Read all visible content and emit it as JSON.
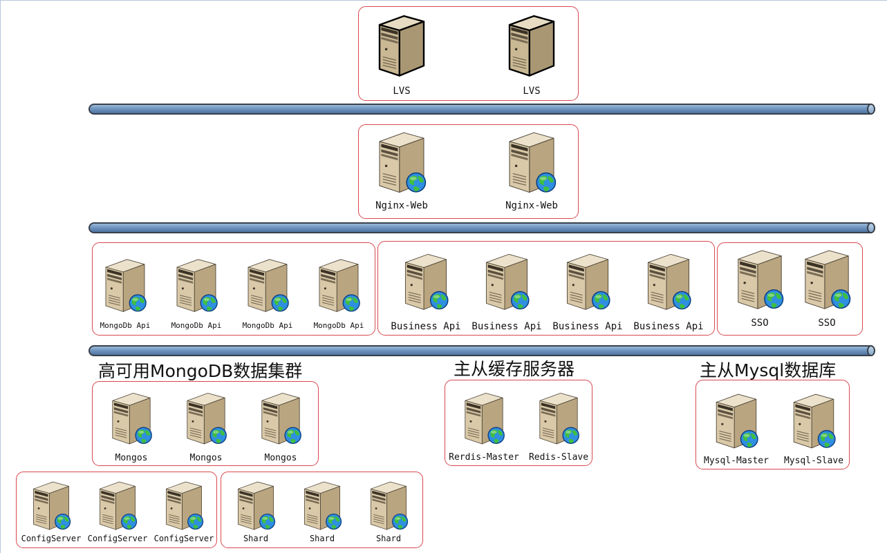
{
  "tiers": {
    "lvs": [
      "LVS",
      "LVS"
    ],
    "nginx": [
      "Nginx-Web",
      "Nginx-Web"
    ],
    "mongo_api": [
      "MongoDb Api",
      "MongoDb Api",
      "MongoDb Api",
      "MongoDb Api"
    ],
    "business_api": [
      "Business Api",
      "Business Api",
      "Business Api",
      "Business Api"
    ],
    "sso": [
      "SSO",
      "SSO"
    ],
    "mongos": [
      "Mongos",
      "Mongos",
      "Mongos"
    ],
    "redis": [
      "Rerdis-Master",
      "Redis-Slave"
    ],
    "mysql": [
      "Mysql-Master",
      "Mysql-Slave"
    ],
    "config_server": [
      "ConfigServer",
      "ConfigServer",
      "ConfigServer"
    ],
    "shard": [
      "Shard",
      "Shard",
      "Shard"
    ]
  },
  "titles": {
    "mongodb_cluster": "高可用MongoDB数据集群",
    "cache": "主从缓存服务器",
    "mysql": "主从Mysql数据库"
  },
  "icons": {
    "plain_server": "server-icon",
    "web_server": "web-server-icon"
  },
  "colors": {
    "group_border": "#d9474d",
    "bus_fill": "#6d92bd",
    "server_body": "#d9c9a8"
  }
}
